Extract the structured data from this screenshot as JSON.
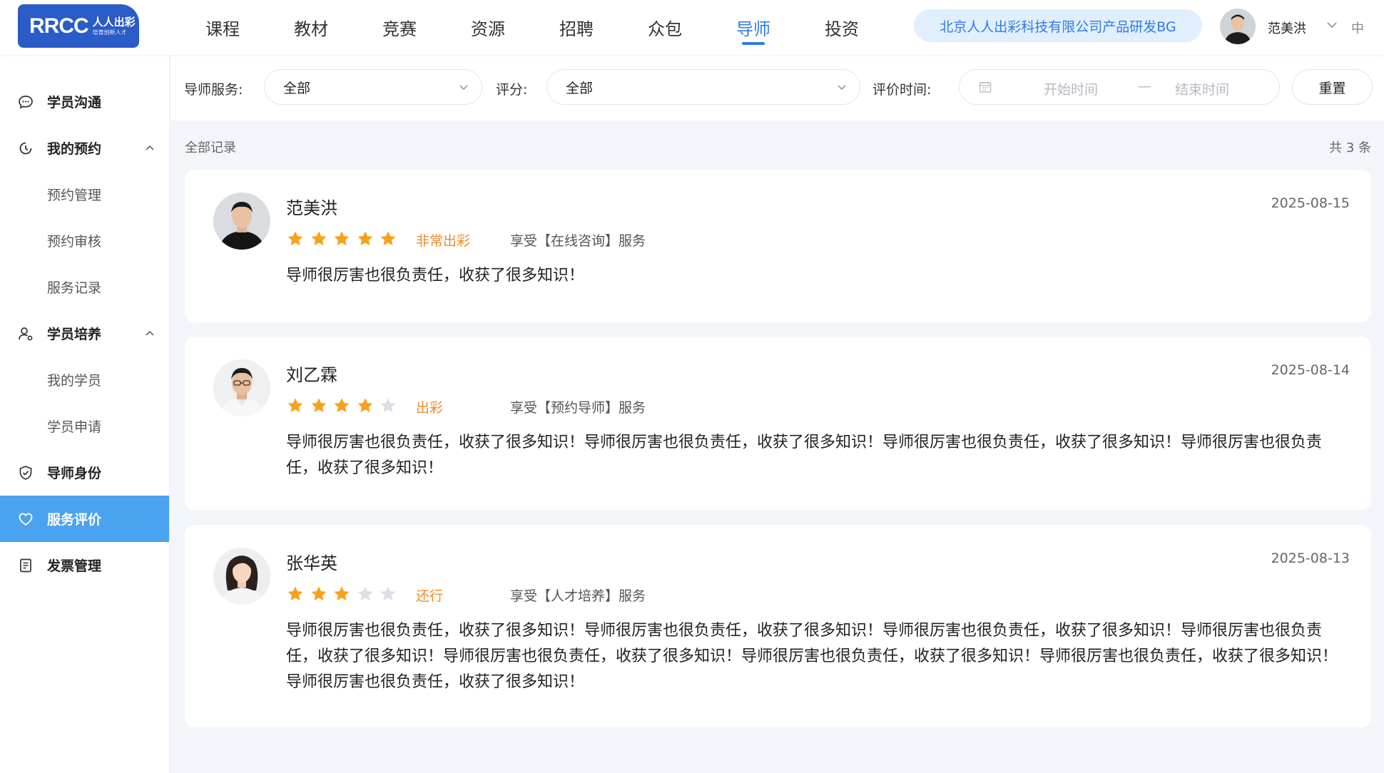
{
  "header": {
    "logo_main": "RRCC",
    "logo_sub1": "人人出彩",
    "logo_sub2": "培育创新人才",
    "nav": [
      "课程",
      "教材",
      "竞赛",
      "资源",
      "招聘",
      "众包",
      "导师",
      "投资"
    ],
    "nav_active": "导师",
    "company": "北京人人出彩科技有限公司产品研发BG",
    "user_name": "范美洪",
    "lang": "中"
  },
  "sidebar": {
    "items": [
      {
        "label": "学员沟通",
        "type": "group",
        "icon": "chat-icon"
      },
      {
        "label": "我的预约",
        "type": "group",
        "icon": "clock-icon",
        "expanded": true
      },
      {
        "label": "预约管理",
        "type": "sub"
      },
      {
        "label": "预约审核",
        "type": "sub"
      },
      {
        "label": "服务记录",
        "type": "sub"
      },
      {
        "label": "学员培养",
        "type": "group",
        "icon": "user-icon",
        "expanded": true
      },
      {
        "label": "我的学员",
        "type": "sub"
      },
      {
        "label": "学员申请",
        "type": "sub"
      },
      {
        "label": "导师身份",
        "type": "group",
        "icon": "shield-check-icon"
      },
      {
        "label": "服务评价",
        "type": "group",
        "icon": "heart-icon",
        "active": true
      },
      {
        "label": "发票管理",
        "type": "group",
        "icon": "invoice-icon"
      }
    ]
  },
  "filter": {
    "service_label": "导师服务:",
    "service_value": "全部",
    "score_label": "评分:",
    "score_value": "全部",
    "time_label": "评价时间:",
    "start_placeholder": "开始时间",
    "separator": "—",
    "end_placeholder": "结束时间",
    "reset": "重置"
  },
  "records": {
    "title": "全部记录",
    "count_text": "共 3 条",
    "list": [
      {
        "name": "范美洪",
        "date": "2025-08-15",
        "rating": 5,
        "grade": "非常出彩",
        "service": "享受【在线咨询】服务",
        "content": "导师很厉害也很负责任，收获了很多知识！"
      },
      {
        "name": "刘乙霖",
        "date": "2025-08-14",
        "rating": 4,
        "grade": "出彩",
        "service": "享受【预约导师】服务",
        "content": "导师很厉害也很负责任，收获了很多知识！导师很厉害也很负责任，收获了很多知识！导师很厉害也很负责任，收获了很多知识！导师很厉害也很负责任，收获了很多知识！"
      },
      {
        "name": "张华英",
        "date": "2025-08-13",
        "rating": 3,
        "grade": "还行",
        "service": "享受【人才培养】服务",
        "content": "导师很厉害也很负责任，收获了很多知识！导师很厉害也很负责任，收获了很多知识！导师很厉害也很负责任，收获了很多知识！导师很厉害也很负责任，收获了很多知识！导师很厉害也很负责任，收获了很多知识！导师很厉害也很负责任，收获了很多知识！导师很厉害也很负责任，收获了很多知识！导师很厉害也很负责任，收获了很多知识！"
      }
    ]
  },
  "colors": {
    "primary": "#2f7be8",
    "sidebar_active": "#4aa3ee",
    "star_on": "#f7a11a",
    "star_off": "#dcdfe5",
    "grade": "#f08a24"
  }
}
